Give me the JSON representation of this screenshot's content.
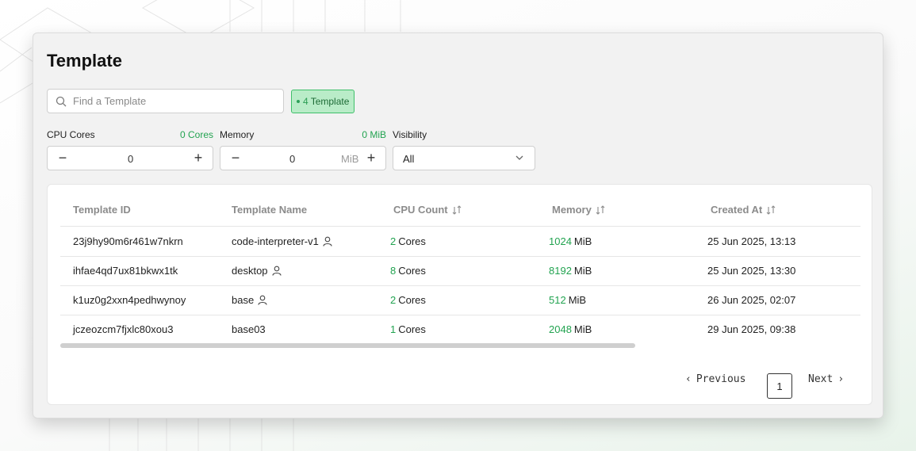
{
  "page_title": "Template",
  "search": {
    "placeholder": "Find a Template",
    "value": ""
  },
  "badge": {
    "count": "4",
    "label": "Template"
  },
  "filters": {
    "cpu": {
      "label": "CPU Cores",
      "summary": "0 Cores",
      "value": "0",
      "minus": "−",
      "plus": "+"
    },
    "memory": {
      "label": "Memory",
      "summary": "0 MiB",
      "value": "0",
      "unit": "MiB",
      "minus": "−",
      "plus": "+"
    },
    "visibility": {
      "label": "Visibility",
      "selected": "All"
    }
  },
  "table": {
    "columns": [
      "Template ID",
      "Template Name",
      "CPU Count",
      "Memory",
      "Created At"
    ],
    "rows": [
      {
        "id": "23j9hy90m6r461w7nkrn",
        "name": "code-interpreter-v1",
        "owner_icon": true,
        "cpu": "2",
        "cpu_unit": "Cores",
        "memory": "1024",
        "memory_unit": "MiB",
        "created": "25 Jun 2025, 13:13"
      },
      {
        "id": "ihfae4qd7ux81bkwx1tk",
        "name": "desktop",
        "owner_icon": true,
        "cpu": "8",
        "cpu_unit": "Cores",
        "memory": "8192",
        "memory_unit": "MiB",
        "created": "25 Jun 2025, 13:30"
      },
      {
        "id": "k1uz0g2xxn4pedhwynoy",
        "name": "base",
        "owner_icon": true,
        "cpu": "2",
        "cpu_unit": "Cores",
        "memory": "512",
        "memory_unit": "MiB",
        "created": "26 Jun 2025, 02:07"
      },
      {
        "id": "jczeozcm7fjxlc80xou3",
        "name": "base03",
        "owner_icon": false,
        "cpu": "1",
        "cpu_unit": "Cores",
        "memory": "2048",
        "memory_unit": "MiB",
        "created": "29 Jun 2025, 09:38"
      }
    ]
  },
  "pagination": {
    "previous": "Previous",
    "page": "1",
    "next": "Next"
  },
  "icons": {
    "search": "search-icon",
    "user": "user-icon",
    "sort": "sort-icon",
    "chevron": "chevron-down-icon"
  },
  "colors": {
    "accent": "#22a350",
    "badge_bg": "#b9ecc8"
  }
}
